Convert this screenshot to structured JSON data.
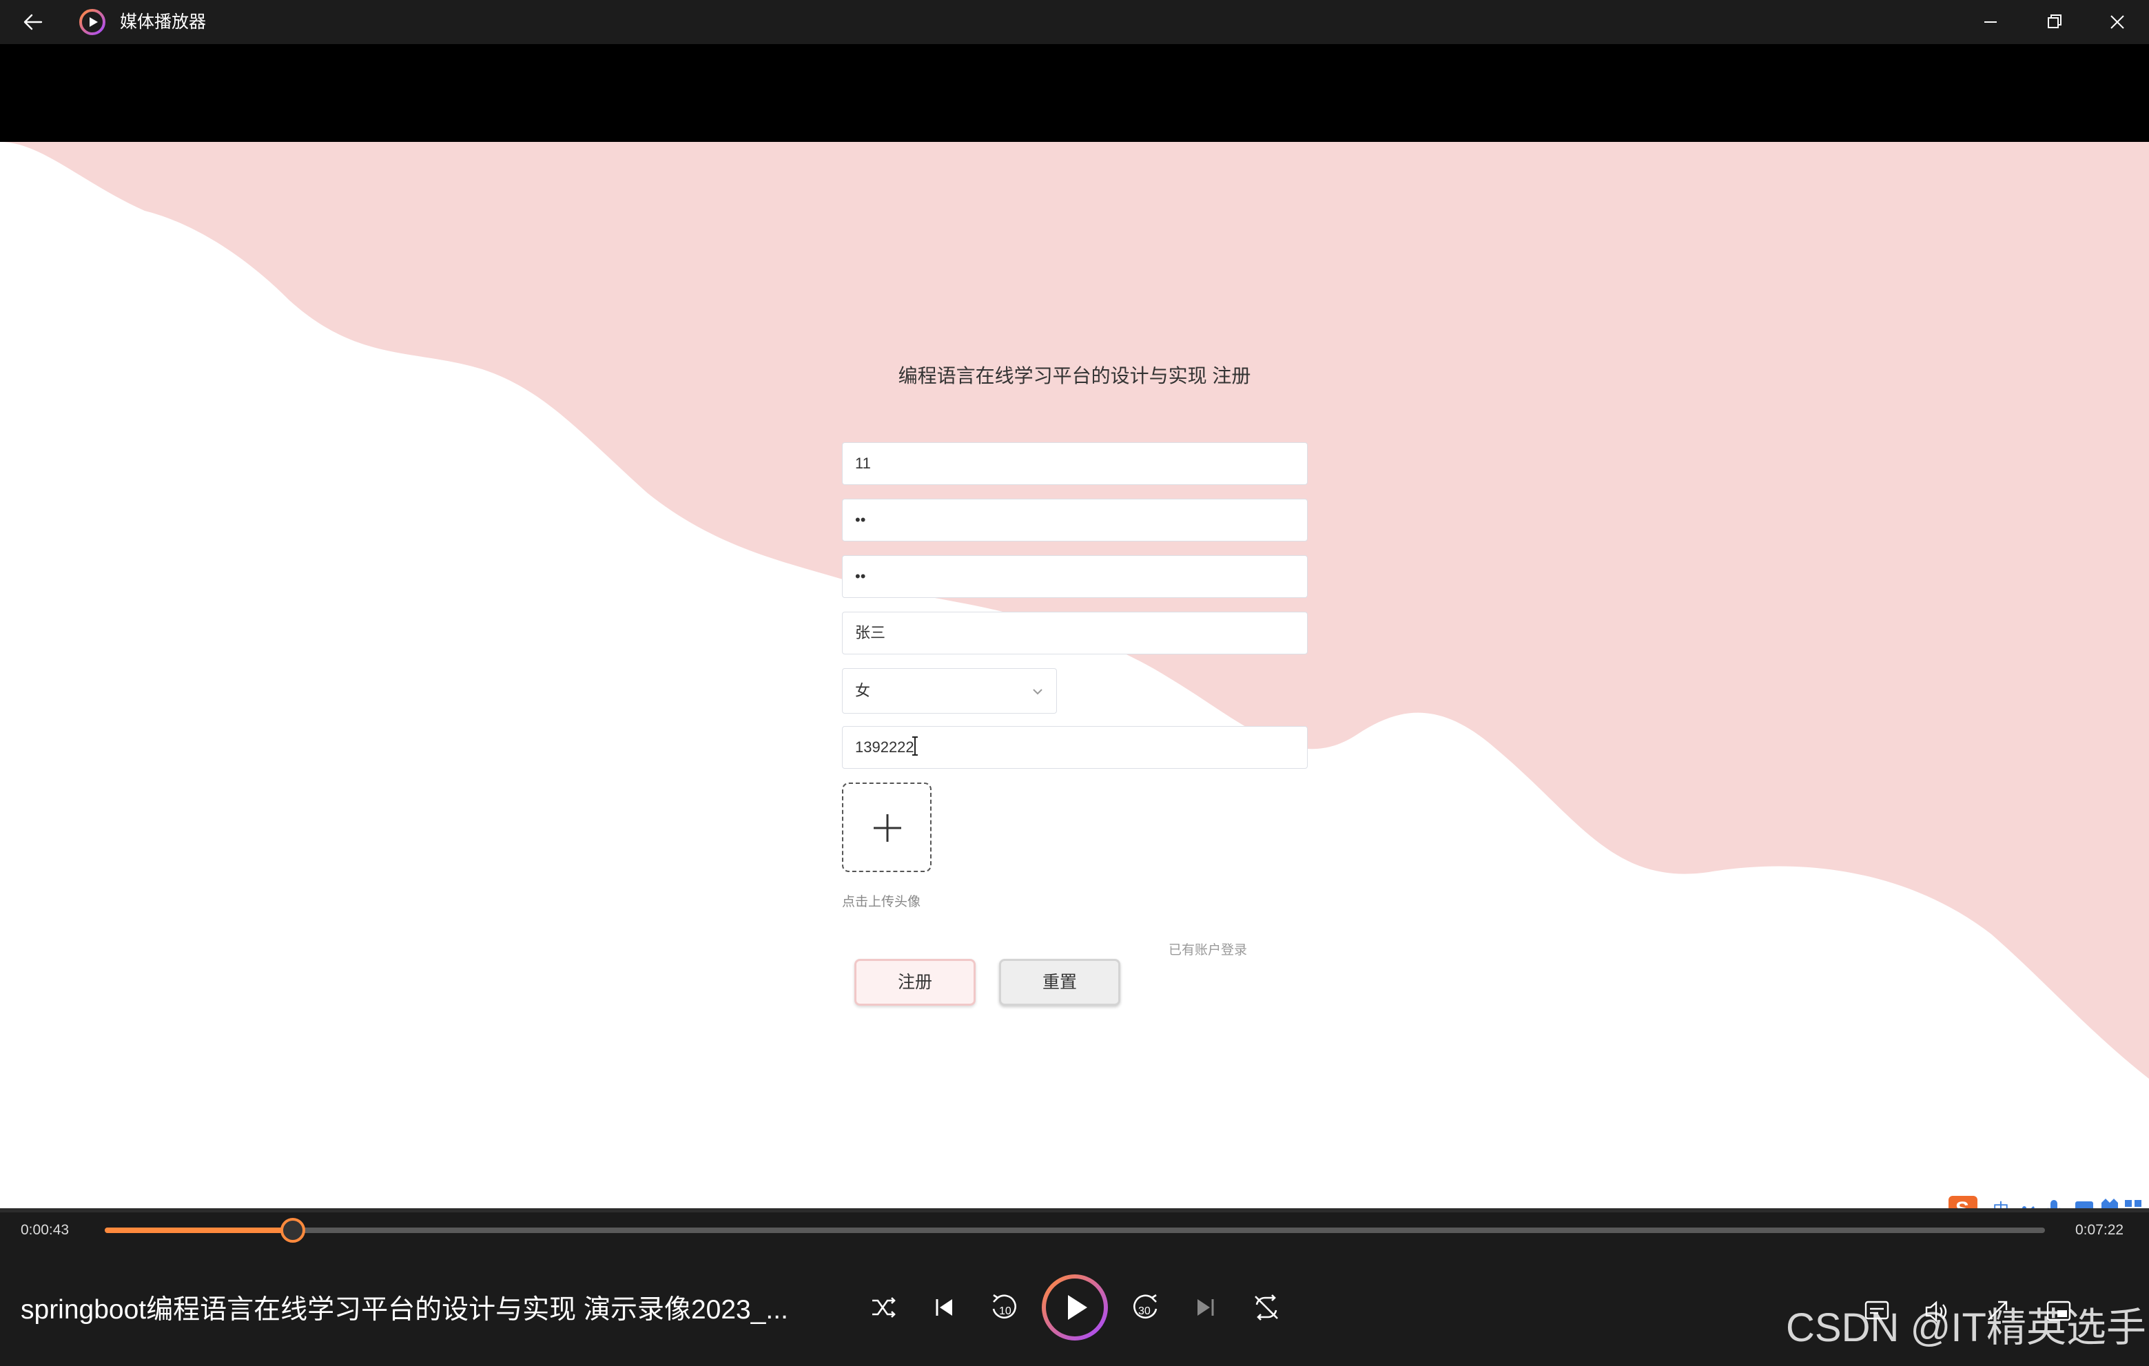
{
  "window": {
    "app_title": "媒体播放器"
  },
  "page": {
    "title": "编程语言在线学习平台的设计与实现 注册",
    "fields": {
      "account": "11",
      "password": "••",
      "confirm_password": "••",
      "name": "张三",
      "gender": "女",
      "phone": "1392222"
    },
    "upload_hint": "点击上传头像",
    "login_link": "已有账户登录",
    "register_button": "注册",
    "reset_button": "重置"
  },
  "player": {
    "current_time": "0:00:43",
    "total_time": "0:07:22",
    "progress": 0.097,
    "now_playing": "springboot编程语言在线学习平台的设计与实现  演示录像2023_...",
    "colors": {
      "accent": "#ff8a3d",
      "play_ring_start": "#ff8a3d",
      "play_ring_end": "#a64aff"
    }
  },
  "watermark": "CSDN @IT精英选手",
  "colors": {
    "wave_pink": "#f7d7d6",
    "ime_s_logo": "#f06a2a",
    "ime_blue": "#3b7fe0"
  }
}
